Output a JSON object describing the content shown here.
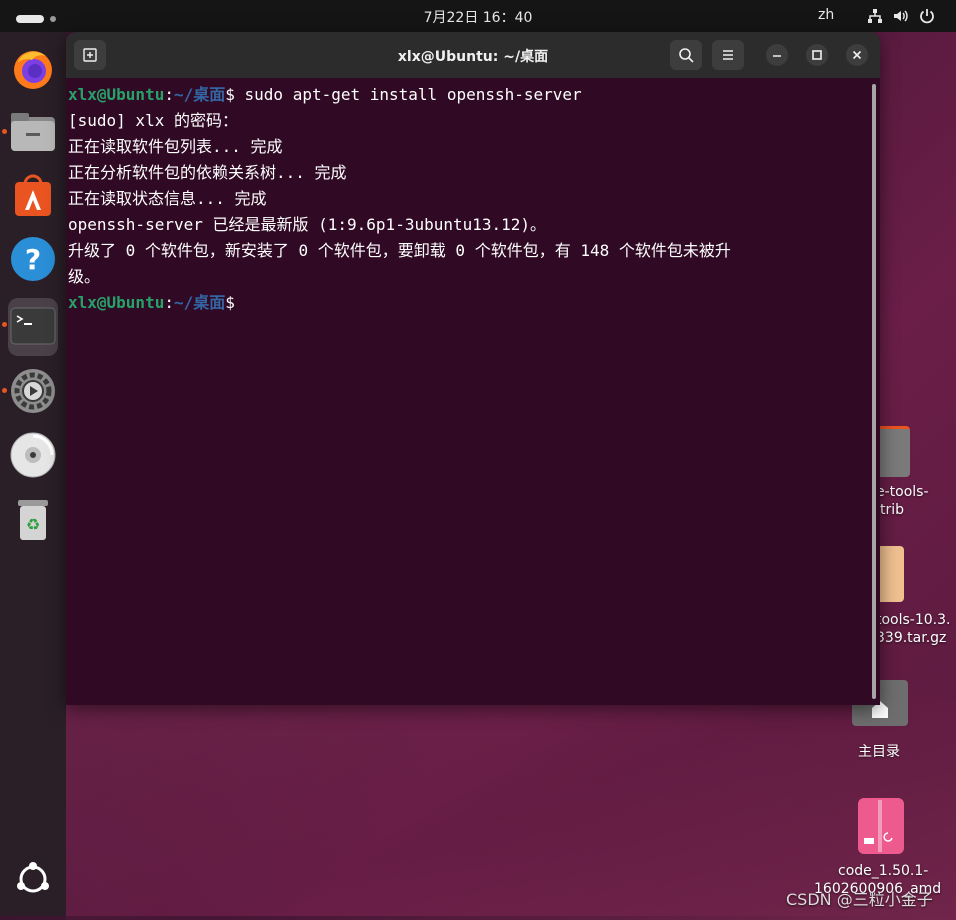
{
  "topbar": {
    "clock": "7月22日  16：40",
    "language": "zh",
    "tray_icons": [
      "network-icon",
      "volume-icon",
      "power-icon"
    ]
  },
  "dock": {
    "items": [
      {
        "name": "firefox",
        "icon": "firefox-icon",
        "running": false,
        "active": false
      },
      {
        "name": "files",
        "icon": "files-icon",
        "running": true,
        "active": false
      },
      {
        "name": "app-center",
        "icon": "app-center-icon",
        "running": false,
        "active": false
      },
      {
        "name": "help",
        "icon": "help-icon",
        "running": false,
        "active": false
      },
      {
        "name": "terminal",
        "icon": "terminal-icon",
        "running": true,
        "active": true
      },
      {
        "name": "settings",
        "icon": "settings-icon",
        "running": true,
        "active": false
      },
      {
        "name": "disc",
        "icon": "disc-icon",
        "running": false,
        "active": false
      },
      {
        "name": "trash",
        "icon": "trash-icon",
        "running": false,
        "active": false
      }
    ],
    "show_apps_icon": "ubuntu-logo-icon"
  },
  "window": {
    "title": "xlx@Ubuntu: ~/桌面",
    "buttons": [
      "new-tab-icon",
      "search-icon",
      "menu-icon",
      "minimize-icon",
      "maximize-icon",
      "close-icon"
    ]
  },
  "terminal": {
    "prompt_user": "xlx@Ubuntu",
    "prompt_sep": ":",
    "prompt_path": "~/桌面",
    "prompt_symbol": "$",
    "command": " sudo apt-get install openssh-server",
    "output": [
      "[sudo] xlx 的密码：",
      "正在读取软件包列表... 完成",
      "正在分析软件包的依赖关系树... 完成",
      "正在读取状态信息... 完成",
      "openssh-server 已经是最新版 (1:9.6p1-3ubuntu13.12)。",
      "升级了 0 个软件包，新安装了 0 个软件包，要卸载 0 个软件包，有 148 个软件包未被升",
      "级。"
    ]
  },
  "desktop": {
    "icons": [
      {
        "label_line1": "e-tools-",
        "label_line2": "trib"
      },
      {
        "label_line1": "tools-10.3.",
        "label_line2": "339.tar.gz"
      },
      {
        "label_line1": "主目录",
        "label_line2": ""
      },
      {
        "label_line1": "code_1.50.1-",
        "label_line2": "1602600906_amd"
      }
    ]
  },
  "watermark": "CSDN @三粒小金子",
  "colors": {
    "terminal_bg": "#300a24",
    "prompt_user": "#26a269",
    "prompt_path": "#3465a4",
    "accent": "#e95420"
  }
}
